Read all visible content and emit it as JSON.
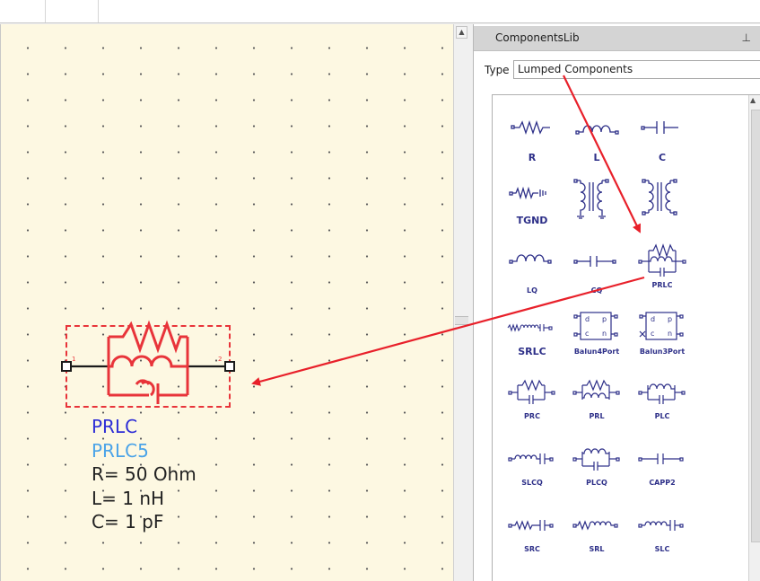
{
  "panel": {
    "title": "ComponentsLib",
    "type_label": "Type",
    "type_value": "Lumped Components",
    "pin_icon": "pin-icon"
  },
  "components": [
    {
      "label": "R",
      "icon": "resistor-icon"
    },
    {
      "label": "L",
      "icon": "inductor-icon"
    },
    {
      "label": "C",
      "icon": "capacitor-icon"
    },
    {
      "label": "TGND",
      "icon": "tgnd-icon"
    },
    {
      "label": "",
      "icon": "transformer-icon"
    },
    {
      "label": "",
      "icon": "transformer-icon"
    },
    {
      "label": "LQ",
      "icon": "inductor-q-icon"
    },
    {
      "label": "CQ",
      "icon": "capacitor-q-icon"
    },
    {
      "label": "PRLC",
      "icon": "parallel-rlc-icon"
    },
    {
      "label": "SRLC",
      "icon": "series-rlc-icon"
    },
    {
      "label": "Balun4Port",
      "icon": "balun4port-icon"
    },
    {
      "label": "Balun3Port",
      "icon": "balun3port-icon"
    },
    {
      "label": "PRC",
      "icon": "parallel-rc-icon"
    },
    {
      "label": "PRL",
      "icon": "parallel-rl-icon"
    },
    {
      "label": "PLC",
      "icon": "parallel-lc-icon"
    },
    {
      "label": "SLCQ",
      "icon": "series-lc-q-icon"
    },
    {
      "label": "PLCQ",
      "icon": "parallel-lc-q-icon"
    },
    {
      "label": "CAPP2",
      "icon": "capp2-icon"
    },
    {
      "label": "SRC",
      "icon": "series-rc-icon"
    },
    {
      "label": "SRL",
      "icon": "series-rl-icon"
    },
    {
      "label": "SLC",
      "icon": "series-lc-icon"
    }
  ],
  "placed_component": {
    "name": "PRLC",
    "instance": "PRLC5",
    "params": [
      "R= 50 Ohm",
      "L= 1 nH",
      "C= 1 pF"
    ]
  },
  "colors": {
    "canvas_bg": "#fdf8e2",
    "symbol_red": "#e8343a",
    "name_color": "#2e2ed6",
    "instance_color": "#4aa3e8",
    "param_color": "#222222",
    "lib_icon_color": "#2d2f88"
  }
}
